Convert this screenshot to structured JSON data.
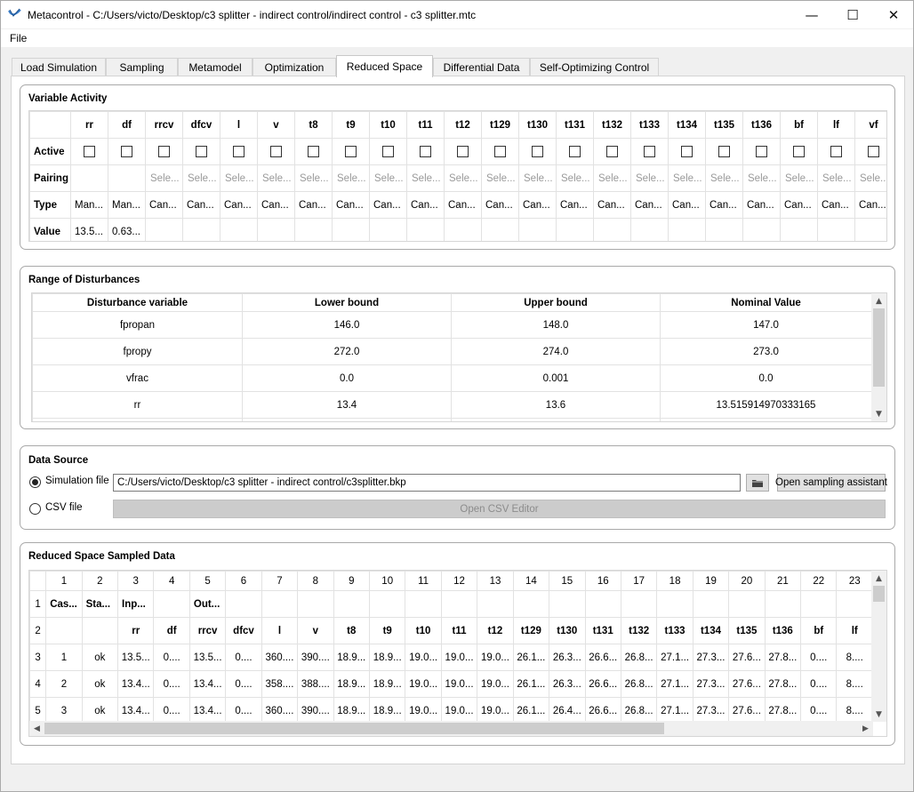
{
  "window": {
    "title": "Metacontrol - C:/Users/victo/Desktop/c3 splitter - indirect control/indirect control - c3 splitter.mtc",
    "minimize": "—",
    "maximize": "☐",
    "close": "✕"
  },
  "menu": {
    "file": "File"
  },
  "tabs": [
    "Load Simulation",
    "Sampling",
    "Metamodel",
    "Optimization",
    "Reduced Space",
    "Differential Data",
    "Self-Optimizing Control"
  ],
  "active_tab": "Reduced Space",
  "variable_activity": {
    "title": "Variable Activity",
    "row_labels": {
      "active": "Active",
      "pairing": "Pairing",
      "type": "Type",
      "value": "Value"
    },
    "columns": [
      "rr",
      "df",
      "rrcv",
      "dfcv",
      "l",
      "v",
      "t8",
      "t9",
      "t10",
      "t11",
      "t12",
      "t129",
      "t130",
      "t131",
      "t132",
      "t133",
      "t134",
      "t135",
      "t136",
      "bf",
      "lf",
      "vf"
    ],
    "pairing": [
      "",
      "",
      "Sele...",
      "Sele...",
      "Sele...",
      "Sele...",
      "Sele...",
      "Sele...",
      "Sele...",
      "Sele...",
      "Sele...",
      "Sele...",
      "Sele...",
      "Sele...",
      "Sele...",
      "Sele...",
      "Sele...",
      "Sele...",
      "Sele...",
      "Sele...",
      "Sele...",
      "Sele..."
    ],
    "type": [
      "Man...",
      "Man...",
      "Can...",
      "Can...",
      "Can...",
      "Can...",
      "Can...",
      "Can...",
      "Can...",
      "Can...",
      "Can...",
      "Can...",
      "Can...",
      "Can...",
      "Can...",
      "Can...",
      "Can...",
      "Can...",
      "Can...",
      "Can...",
      "Can...",
      "Can..."
    ],
    "value": [
      "13.5...",
      "0.63...",
      "",
      "",
      "",
      "",
      "",
      "",
      "",
      "",
      "",
      "",
      "",
      "",
      "",
      "",
      "",
      "",
      "",
      "",
      "",
      ""
    ]
  },
  "disturbances": {
    "title": "Range of Disturbances",
    "headers": [
      "Disturbance variable",
      "Lower bound",
      "Upper bound",
      "Nominal Value"
    ],
    "rows": [
      [
        "fpropan",
        "146.0",
        "148.0",
        "147.0"
      ],
      [
        "fpropy",
        "272.0",
        "274.0",
        "273.0"
      ],
      [
        "vfrac",
        "0.0",
        "0.001",
        "0.0"
      ],
      [
        "rr",
        "13.4",
        "13.6",
        "13.515914970333165"
      ]
    ]
  },
  "data_source": {
    "title": "Data Source",
    "simulation_label": "Simulation file",
    "simulation_path": "C:/Users/victo/Desktop/c3 splitter - indirect control/c3splitter.bkp",
    "csv_label": "CSV file",
    "open_sampling": "Open sampling assistant",
    "open_csv": "Open CSV Editor",
    "selected": "simulation"
  },
  "sampled": {
    "title": "Reduced Space Sampled Data",
    "col_numbers": [
      "1",
      "2",
      "3",
      "4",
      "5",
      "6",
      "7",
      "8",
      "9",
      "10",
      "11",
      "12",
      "13",
      "14",
      "15",
      "16",
      "17",
      "18",
      "19",
      "20",
      "21",
      "22",
      "23"
    ],
    "row_numbers": [
      "1",
      "2",
      "3",
      "4",
      "5"
    ],
    "rows": [
      [
        "Cas...",
        "Sta...",
        "Inp...",
        "",
        "Out...",
        "",
        "",
        "",
        "",
        "",
        "",
        "",
        "",
        "",
        "",
        "",
        "",
        "",
        "",
        "",
        "",
        "",
        ""
      ],
      [
        "",
        "",
        "rr",
        "df",
        "rrcv",
        "dfcv",
        "l",
        "v",
        "t8",
        "t9",
        "t10",
        "t11",
        "t12",
        "t129",
        "t130",
        "t131",
        "t132",
        "t133",
        "t134",
        "t135",
        "t136",
        "bf",
        "lf"
      ],
      [
        "1",
        "ok",
        "13.5...",
        "0....",
        "13.5...",
        "0....",
        "360....",
        "390....",
        "18.9...",
        "18.9...",
        "19.0...",
        "19.0...",
        "19.0...",
        "26.1...",
        "26.3...",
        "26.6...",
        "26.8...",
        "27.1...",
        "27.3...",
        "27.6...",
        "27.8...",
        "0....",
        "8...."
      ],
      [
        "2",
        "ok",
        "13.4...",
        "0....",
        "13.4...",
        "0....",
        "358....",
        "388....",
        "18.9...",
        "18.9...",
        "19.0...",
        "19.0...",
        "19.0...",
        "26.1...",
        "26.3...",
        "26.6...",
        "26.8...",
        "27.1...",
        "27.3...",
        "27.6...",
        "27.8...",
        "0....",
        "8...."
      ],
      [
        "3",
        "ok",
        "13.4...",
        "0....",
        "13.4...",
        "0....",
        "360....",
        "390....",
        "18.9...",
        "18.9...",
        "19.0...",
        "19.0...",
        "19.0...",
        "26.1...",
        "26.4...",
        "26.6...",
        "26.8...",
        "27.1...",
        "27.3...",
        "27.6...",
        "27.8...",
        "0....",
        "8...."
      ]
    ]
  },
  "icons": {
    "folder": "folder-icon",
    "app": "metacontrol-icon"
  },
  "colors": {
    "disabled_button": "#cccccc",
    "disabled_text": "#8c8c8c"
  }
}
